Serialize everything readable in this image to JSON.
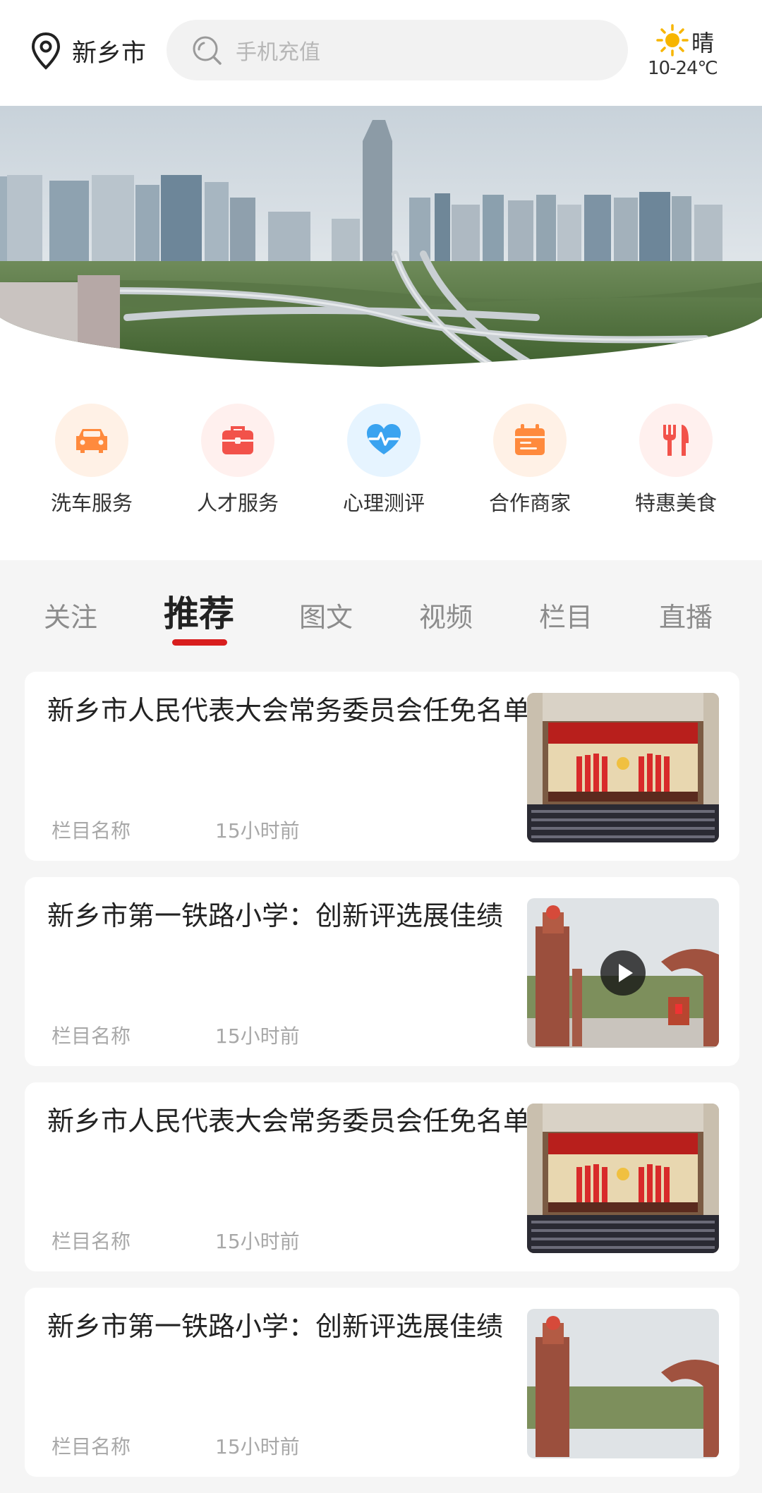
{
  "header": {
    "location": "新乡市",
    "search_placeholder": "手机充值",
    "weather": {
      "condition": "晴",
      "temperature": "10-24℃"
    }
  },
  "services": [
    {
      "label": "洗车服务",
      "icon": "car-icon",
      "color": "#ff8a3d",
      "bg": "#fff1e6"
    },
    {
      "label": "人才服务",
      "icon": "briefcase-icon",
      "color": "#f2524a",
      "bg": "#fff0ee"
    },
    {
      "label": "心理测评",
      "icon": "heart-pulse-icon",
      "color": "#3aa3f0",
      "bg": "#e6f4ff"
    },
    {
      "label": "合作商家",
      "icon": "calendar-icon",
      "color": "#ff8a3d",
      "bg": "#fff1e6"
    },
    {
      "label": "特惠美食",
      "icon": "food-icon",
      "color": "#f2524a",
      "bg": "#fff0ee"
    }
  ],
  "tabs": [
    {
      "label": "关注",
      "active": false
    },
    {
      "label": "推荐",
      "active": true
    },
    {
      "label": "图文",
      "active": false
    },
    {
      "label": "视频",
      "active": false
    },
    {
      "label": "栏目",
      "active": false
    },
    {
      "label": "直播",
      "active": false
    }
  ],
  "news": [
    {
      "title": "新乡市人民代表大会常务委员会任免名单",
      "column": "栏目名称",
      "time": "15小时前",
      "video": false
    },
    {
      "title": "新乡市第一铁路小学：创新评选展佳绩",
      "column": "栏目名称",
      "time": "15小时前",
      "video": true
    },
    {
      "title": "新乡市人民代表大会常务委员会任免名单",
      "column": "栏目名称",
      "time": "15小时前",
      "video": false
    },
    {
      "title": "新乡市第一铁路小学：创新评选展佳绩",
      "column": "栏目名称",
      "time": "15小时前",
      "video": false
    }
  ],
  "colors": {
    "accent": "#d81e1e"
  }
}
